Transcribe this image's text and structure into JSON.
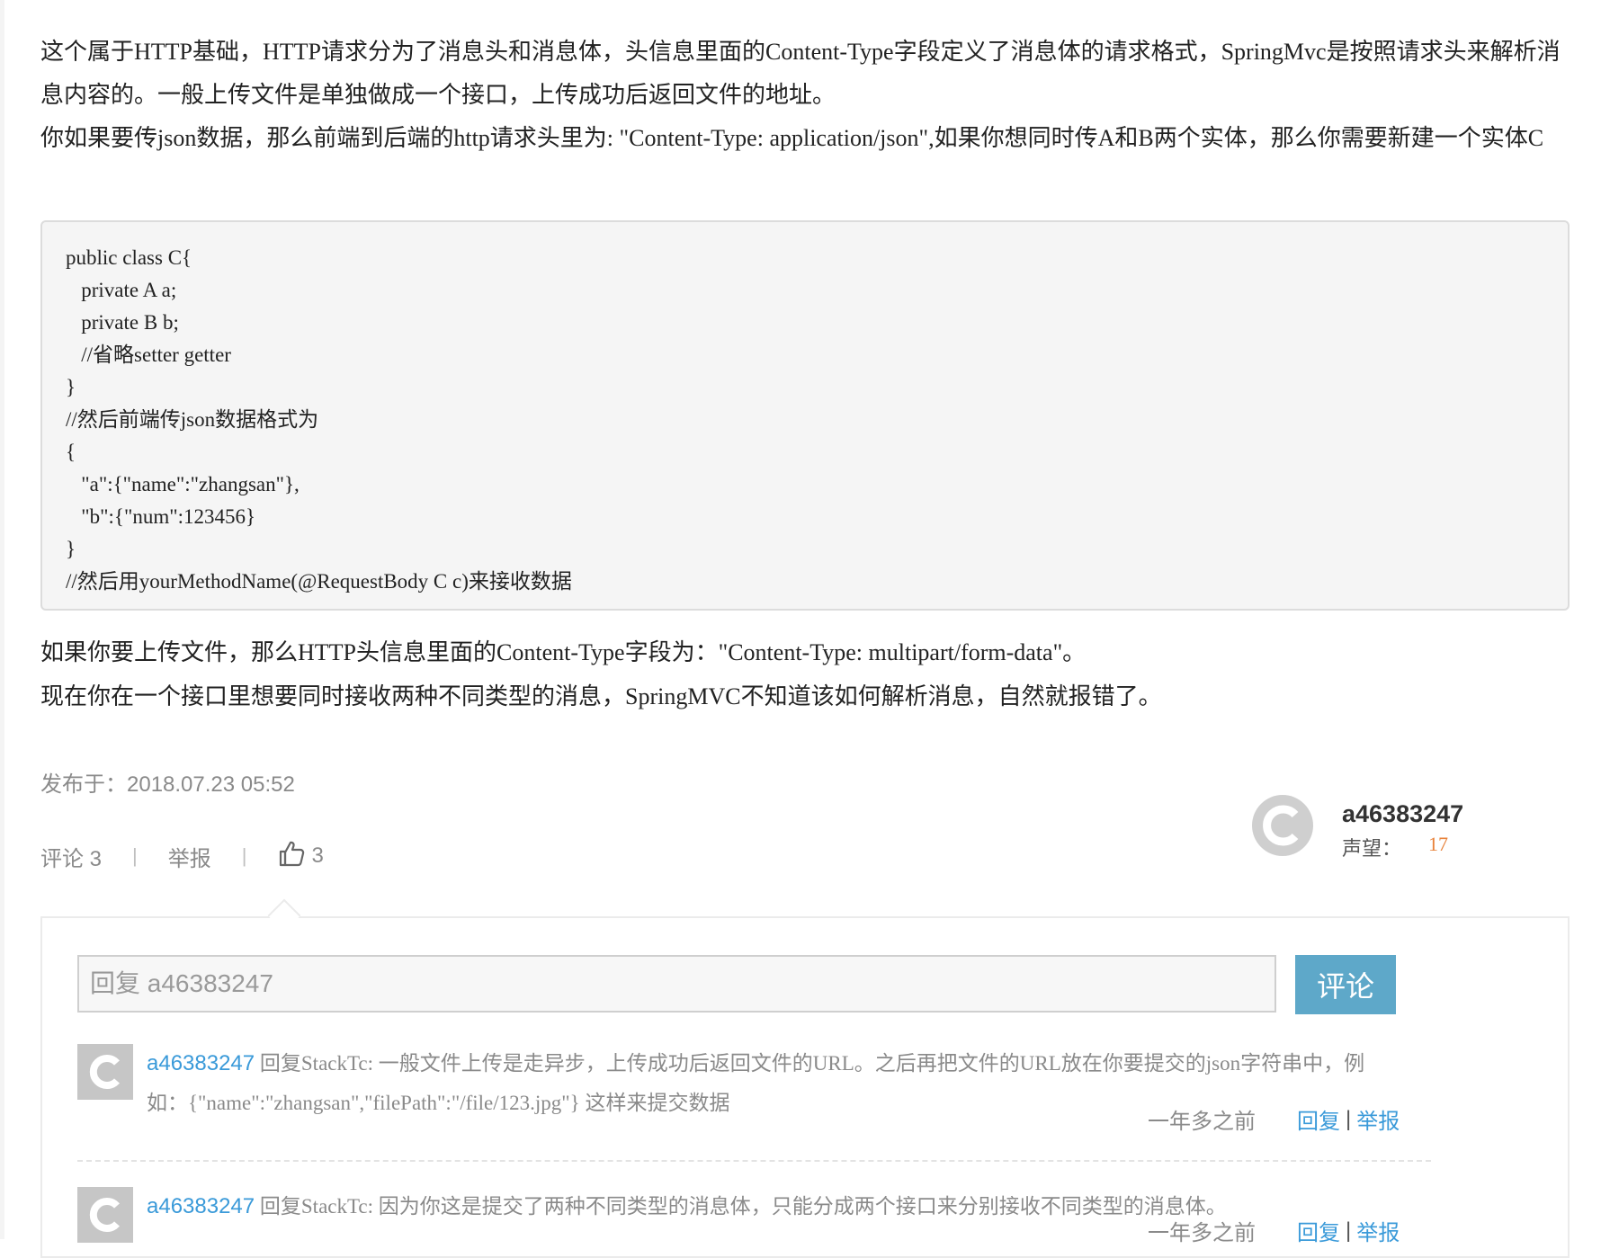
{
  "answer": {
    "para1": "这个属于HTTP基础，HTTP请求分为了消息头和消息体，头信息里面的Content-Type字段定义了消息体的请求格式，SpringMvc是按照请求头来解析消息内容的。一般上传文件是单独做成一个接口，上传成功后返回文件的地址。",
    "para2": "你如果要传json数据，那么前端到后端的http请求头里为: \"Content-Type: application/json\",如果你想同时传A和B两个实体，那么你需要新建一个实体C",
    "code_lines": [
      "public class C{",
      "   private A a;",
      "   private B b;",
      "   //省略setter getter",
      "}",
      "//然后前端传json数据格式为",
      "{",
      "   \"a\":{\"name\":\"zhangsan\"},",
      "   \"b\":{\"num\":123456}",
      "}",
      "//然后用yourMethodName(@RequestBody C c)来接收数据"
    ],
    "para3": "如果你要上传文件，那么HTTP头信息里面的Content-Type字段为：\"Content-Type: multipart/form-data\"。",
    "para4": "现在你在一个接口里想要同时接收两种不同类型的消息，SpringMVC不知道该如何解析消息，自然就报错了。"
  },
  "meta": {
    "published": "发布于：2018.07.23 05:52",
    "comments_label": "评论 3",
    "separator": "|",
    "report_label": "举报",
    "likes": "3",
    "thumb_icon": "thumbs-up-icon"
  },
  "author": {
    "name": "a46383247",
    "reputation_label": "声望：",
    "reputation_value": "17"
  },
  "comment_box": {
    "placeholder": "回复 a46383247",
    "submit_label": "评论"
  },
  "comments": [
    {
      "user": "a46383247",
      "text": " 回复StackTc: 一般文件上传是走异步，上传成功后返回文件的URL。之后再把文件的URL放在你要提交的json字符串中，例如：{\"name\":\"zhangsan\",\"filePath\":\"/file/123.jpg\"} 这样来提交数据",
      "time": "一年多之前",
      "reply_label": "回复",
      "separator": "|",
      "report_label": "举报"
    },
    {
      "user": "a46383247",
      "text": " 回复StackTc: 因为你这是提交了两种不同类型的消息体，只能分成两个接口来分别接收不同类型的消息体。",
      "time": "一年多之前",
      "reply_label": "回复",
      "separator": "|",
      "report_label": "举报"
    }
  ],
  "colors": {
    "link": "#3a9ad9",
    "button": "#5ea8c9",
    "reputation": "#e8823a"
  }
}
